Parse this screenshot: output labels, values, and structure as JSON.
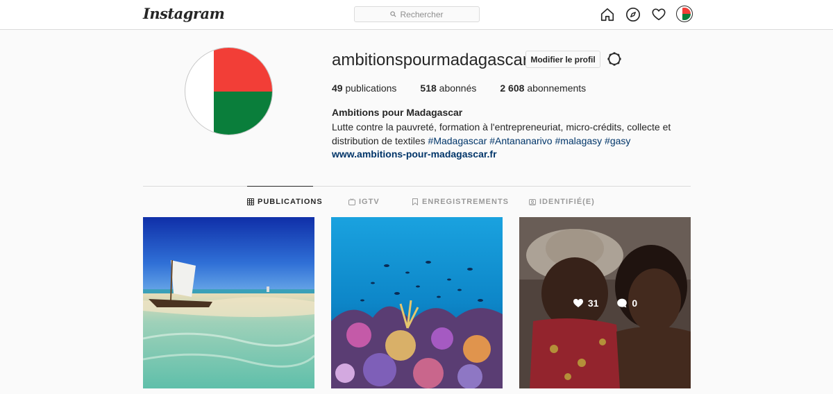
{
  "header": {
    "logo": "Instagram",
    "search_placeholder": "Rechercher",
    "icons": [
      "home-icon",
      "explore-icon",
      "heart-icon",
      "avatar"
    ]
  },
  "profile": {
    "username": "ambitionspourmadagascar",
    "edit_label": "Modifier le profil",
    "stats": {
      "posts_count": "49",
      "posts_label": "publications",
      "followers_count": "518",
      "followers_label": "abonnés",
      "following_count": "2 608",
      "following_label": "abonnements"
    },
    "full_name": "Ambitions pour Madagascar",
    "bio_line1": "Lutte contre la pauvreté, formation à l'entrepreneuriat, micro-crédits, collecte et",
    "bio_line2": "distribution de textiles",
    "hashtags": [
      "#Madagascar",
      "#Antananarivo",
      "#malagasy",
      "#gasy"
    ],
    "website": "www.ambitions-pour-madagascar.fr"
  },
  "tabs": [
    {
      "label": "PUBLICATIONS",
      "icon": "grid-icon",
      "active": true
    },
    {
      "label": "IGTV",
      "icon": "igtv-icon",
      "active": false
    },
    {
      "label": "ENREGISTREMENTS",
      "icon": "bookmark-icon",
      "active": false
    },
    {
      "label": "IDENTIFIÉ(E)",
      "icon": "tagged-icon",
      "active": false
    }
  ],
  "posts": [
    {
      "subject": "beach-boat"
    },
    {
      "subject": "coral-reef"
    },
    {
      "subject": "two-children",
      "likes": "31",
      "comments": "0"
    }
  ],
  "colors": {
    "flag_red": "#f23e37",
    "flag_green": "#0a7e3b",
    "link": "#003569"
  }
}
